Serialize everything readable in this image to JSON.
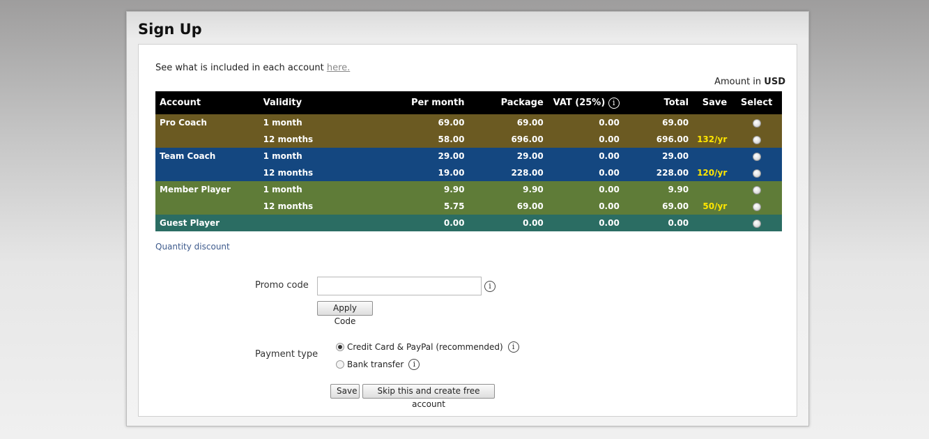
{
  "page": {
    "title": "Sign Up",
    "intro_text": "See what is included in each account ",
    "intro_link": "here.",
    "amount_prefix": "Amount in ",
    "currency": "USD"
  },
  "table": {
    "headers": {
      "account": "Account",
      "validity": "Validity",
      "per_month": "Per month",
      "package": "Package",
      "vat": "VAT (25%)",
      "total": "Total",
      "save": "Save",
      "select": "Select"
    },
    "rows": [
      {
        "account": "Pro Coach",
        "validity": "1 month",
        "per_month": "69.00",
        "package": "69.00",
        "vat": "0.00",
        "total": "69.00",
        "save": ""
      },
      {
        "account": "",
        "validity": "12 months",
        "per_month": "58.00",
        "package": "696.00",
        "vat": "0.00",
        "total": "696.00",
        "save": "132/yr"
      },
      {
        "account": "Team Coach",
        "validity": "1 month",
        "per_month": "29.00",
        "package": "29.00",
        "vat": "0.00",
        "total": "29.00",
        "save": ""
      },
      {
        "account": "",
        "validity": "12 months",
        "per_month": "19.00",
        "package": "228.00",
        "vat": "0.00",
        "total": "228.00",
        "save": "120/yr"
      },
      {
        "account": "Member Player",
        "validity": "1 month",
        "per_month": "9.90",
        "package": "9.90",
        "vat": "0.00",
        "total": "9.90",
        "save": ""
      },
      {
        "account": "",
        "validity": "12 months",
        "per_month": "5.75",
        "package": "69.00",
        "vat": "0.00",
        "total": "69.00",
        "save": "50/yr"
      },
      {
        "account": "Guest Player",
        "validity": "",
        "per_month": "0.00",
        "package": "0.00",
        "vat": "0.00",
        "total": "0.00",
        "save": ""
      }
    ]
  },
  "quantity_discount": "Quantity discount",
  "promo": {
    "label": "Promo code",
    "value": "",
    "apply_label": "Apply Code"
  },
  "payment": {
    "label": "Payment type",
    "options": [
      {
        "label": "Credit Card & PayPal (recommended)",
        "checked": true
      },
      {
        "label": "Bank transfer",
        "checked": false
      }
    ]
  },
  "actions": {
    "save_label": "Save",
    "skip_label": "Skip this and create free account"
  },
  "icons": {
    "info": "i"
  },
  "colors": {
    "pro_row": "#6b5a22",
    "team_row": "#144780",
    "member_row": "#5f7c38",
    "guest_row": "#2b6d63",
    "save_highlight": "#ffe600",
    "header": "#000000"
  }
}
